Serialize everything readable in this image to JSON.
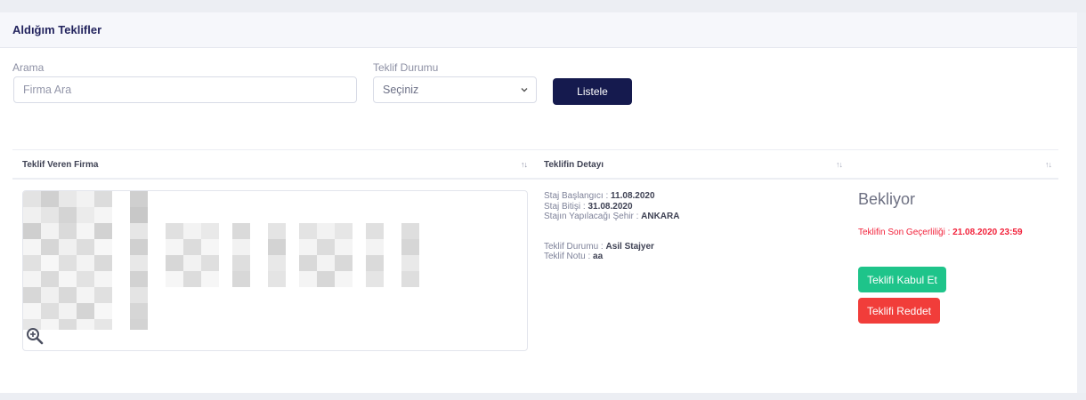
{
  "card": {
    "title": "Aldığım Teklifler"
  },
  "filters": {
    "search_label": "Arama",
    "search_placeholder": "Firma Ara",
    "status_label": "Teklif Durumu",
    "status_selected": "Seçiniz",
    "list_button": "Listele"
  },
  "table": {
    "columns": [
      "Teklif Veren Firma",
      "Teklifin Detayı",
      ""
    ],
    "row": {
      "start_label": "Staj Başlangıcı : ",
      "start_value": "11.08.2020",
      "end_label": "Staj Bitişi : ",
      "end_value": "31.08.2020",
      "city_label": "Stajın Yapılacağı Şehir : ",
      "city_value": "ANKARA",
      "offer_status_label": "Teklif Durumu : ",
      "offer_status_value": "Asil Stajyer",
      "note_label": "Teklif Notu : ",
      "note_value": "aa",
      "status": "Bekliyor",
      "expiry_label": "Teklifin Son Geçerliliği : ",
      "expiry_value": "21.08.2020 23:59",
      "accept_button": "Teklifi Kabul Et",
      "reject_button": "Teklifi Reddet"
    }
  },
  "icons": {
    "sort": "sort-arrows-icon",
    "select": "chevron-down-icon",
    "zoom": "zoom-in-icon"
  },
  "colors": {
    "primary": "#151a4e",
    "success": "#1ec48a",
    "danger": "#f13d3a",
    "expiry": "#f2213a"
  }
}
